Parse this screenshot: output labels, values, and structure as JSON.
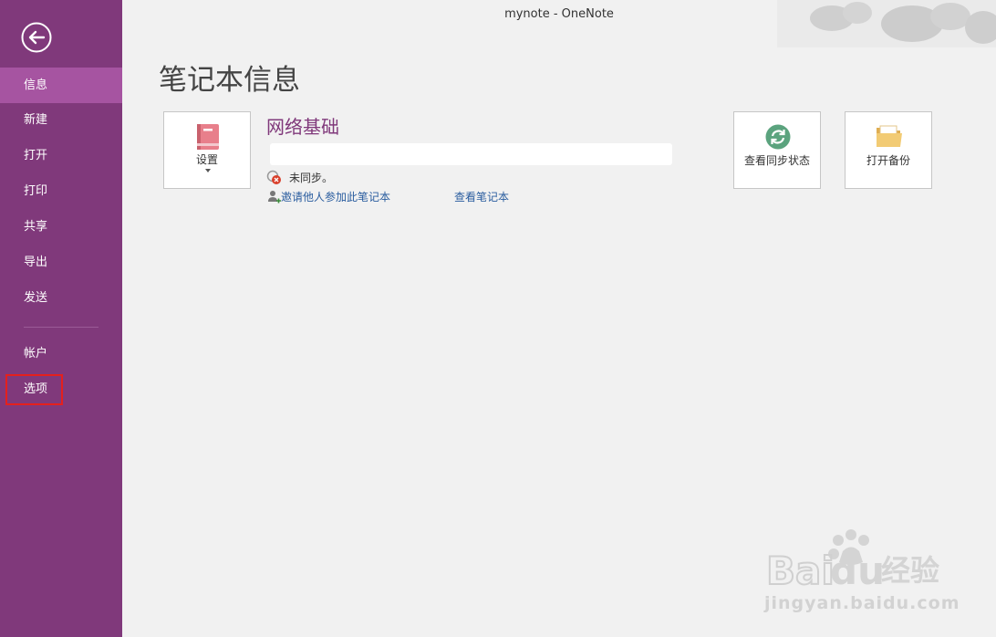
{
  "window": {
    "title": "mynote - OneNote"
  },
  "sidebar": {
    "items": [
      {
        "label": "信息",
        "active": true
      },
      {
        "label": "新建"
      },
      {
        "label": "打开"
      },
      {
        "label": "打印"
      },
      {
        "label": "共享"
      },
      {
        "label": "导出"
      },
      {
        "label": "发送"
      },
      {
        "label": "帐户"
      },
      {
        "label": "选项",
        "highlighted": true
      }
    ]
  },
  "main": {
    "title": "笔记本信息",
    "settings_label": "设置",
    "notebook_name": "网络基础",
    "notebook_path": "",
    "sync_status": "未同步。",
    "invite_link": "邀请他人参加此笔记本",
    "view_link": "查看笔记本",
    "view_sync_label": "查看同步状态",
    "open_backup_label": "打开备份"
  },
  "watermark": {
    "brand": "Baidu经验",
    "url": "jingyan.baidu.com"
  },
  "colors": {
    "sidebar": "#80397b",
    "sidebar_active": "#a654a1",
    "accent": "#80397b",
    "link": "#2a5d9f",
    "highlight": "#e5201d"
  }
}
